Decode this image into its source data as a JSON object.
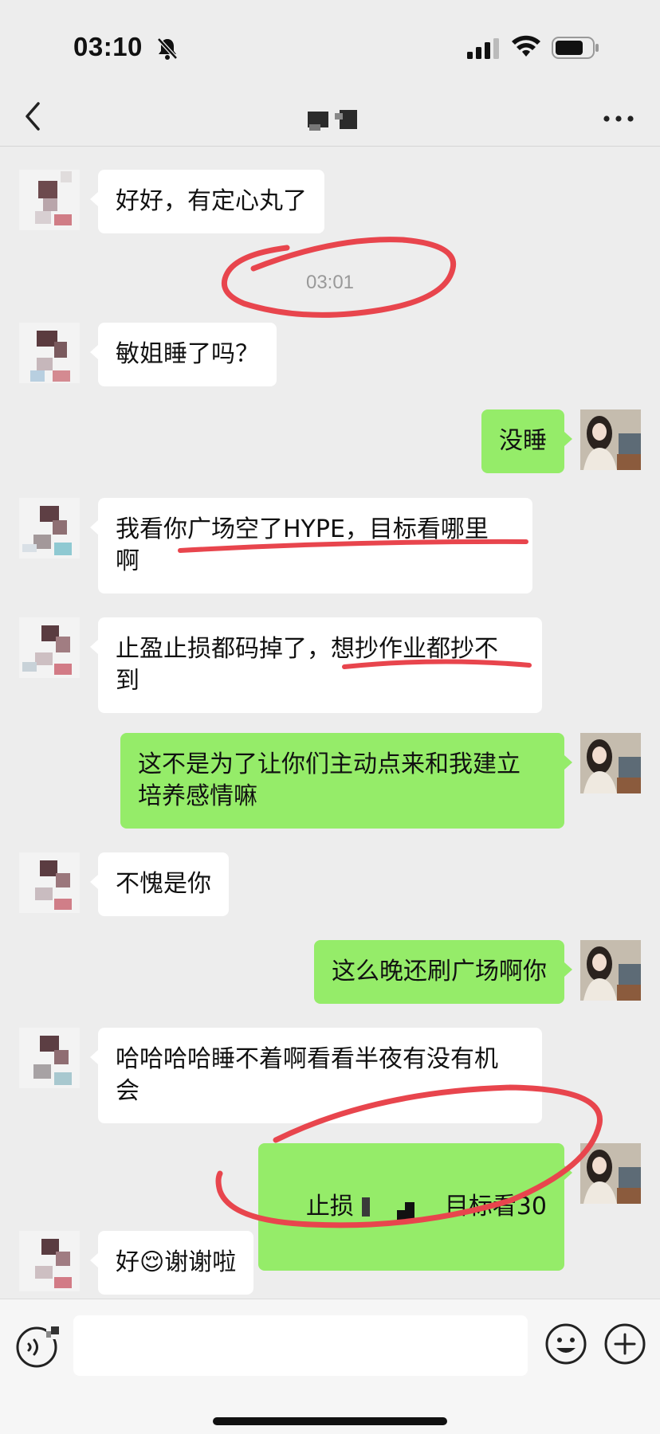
{
  "status_bar": {
    "time": "03:10"
  },
  "nav": {
    "title": ""
  },
  "messages": [
    {
      "side": "left",
      "text": "好好，有定心丸了"
    },
    {
      "type": "time",
      "text": "03:01"
    },
    {
      "side": "left",
      "text": "敏姐睡了吗？"
    },
    {
      "side": "right",
      "text": "没睡"
    },
    {
      "side": "left",
      "text": "我看你广场空了HYPE，目标看哪里\n啊"
    },
    {
      "side": "left",
      "text": "止盈止损都码掉了，想抄作业都抄不\n到"
    },
    {
      "side": "right",
      "text": "这不是为了让你们主动点来和我建立\n培养感情嘛"
    },
    {
      "side": "left",
      "text": "不愧是你"
    },
    {
      "side": "right",
      "text": "这么晚还刷广场啊你"
    },
    {
      "side": "left",
      "text": "哈哈哈哈睡不着啊看看半夜有没有机\n会"
    },
    {
      "side": "right",
      "text_before": "止损",
      "text_after": "目标看30"
    },
    {
      "side": "left",
      "text": "好😌谢谢啦"
    }
  ],
  "input": {
    "value": "",
    "placeholder": ""
  },
  "colors": {
    "bubble_self": "#95ec69",
    "bubble_other": "#ffffff",
    "background": "#ededed",
    "annotation": "#e8454d"
  },
  "icons": [
    "bell-slash-icon",
    "signal-icon",
    "wifi-icon",
    "battery-icon",
    "back-icon",
    "more-icon",
    "voice-icon",
    "emoji-icon",
    "plus-icon"
  ]
}
